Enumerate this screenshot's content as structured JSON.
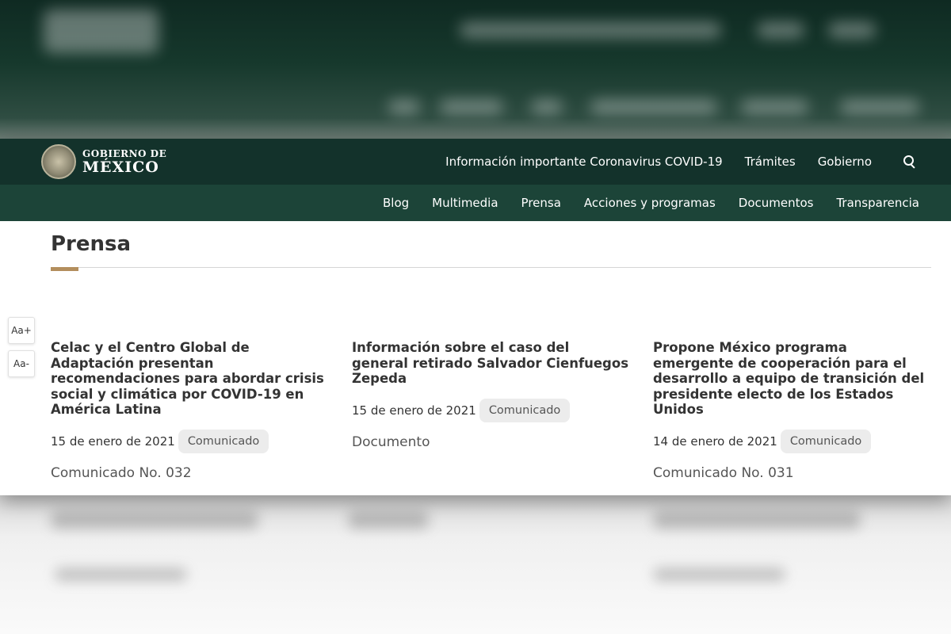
{
  "header": {
    "logo": {
      "line1": "GOBIERNO DE",
      "line2": "MÉXICO"
    },
    "nav": [
      "Información importante Coronavirus COVID-19",
      "Trámites",
      "Gobierno"
    ],
    "search_icon": "search-icon"
  },
  "subnav": [
    "Blog",
    "Multimedia",
    "Prensa",
    "Acciones y programas",
    "Documentos",
    "Transparencia"
  ],
  "page": {
    "title": "Prensa"
  },
  "font_controls": {
    "increase": "Aa+",
    "decrease": "Aa-"
  },
  "cards": [
    {
      "title": "Celac y el Centro Global de Adaptación presentan recomendaciones para abordar crisis social y climática por COVID-19 en América Latina",
      "date": "15 de enero de 2021",
      "badge": "Comunicado",
      "sub": "Comunicado No. 032"
    },
    {
      "title": "Información sobre el caso del general retirado Salvador Cienfuegos Zepeda",
      "date": "15 de enero de 2021",
      "badge": "Comunicado",
      "sub": "Documento"
    },
    {
      "title": "Propone México programa emergente de cooperación para el desarrollo a equipo de transición del presidente electo de los Estados Unidos",
      "date": "14 de enero de 2021",
      "badge": "Comunicado",
      "sub": "Comunicado No. 031"
    }
  ],
  "colors": {
    "header": "#13322b",
    "subnav": "#1c4438",
    "accent": "#b38e5d"
  }
}
